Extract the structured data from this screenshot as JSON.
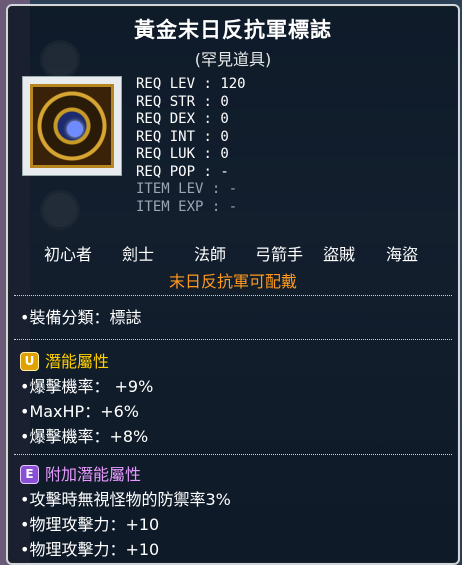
{
  "item": {
    "name": "黃金末日反抗軍標誌",
    "rarity": "(罕見道具)",
    "icon": "gold-emblem-icon"
  },
  "requirements": [
    {
      "label": "REQ LEV",
      "value": "120",
      "dim": false
    },
    {
      "label": "REQ STR",
      "value": "0",
      "dim": false
    },
    {
      "label": "REQ DEX",
      "value": "0",
      "dim": false
    },
    {
      "label": "REQ INT",
      "value": "0",
      "dim": false
    },
    {
      "label": "REQ LUK",
      "value": "0",
      "dim": false
    },
    {
      "label": "REQ POP",
      "value": "-",
      "dim": false
    },
    {
      "label": "ITEM LEV",
      "value": "-",
      "dim": true
    },
    {
      "label": "ITEM EXP",
      "value": "-",
      "dim": true
    }
  ],
  "jobs": [
    "初心者",
    "劍士",
    "法師",
    "弓箭手",
    "盜賊",
    "海盜"
  ],
  "equip_notice": "末日反抗軍可配戴",
  "category_line": "•裝備分類：標誌",
  "potential": {
    "badge": "U",
    "title": "潛能屬性",
    "lines": [
      "•爆擊機率： +9%",
      "•MaxHP：+6%",
      "•爆擊機率：+8%"
    ]
  },
  "bonus_potential": {
    "badge": "E",
    "title": "附加潛能屬性",
    "lines": [
      "•攻擊時無視怪物的防禦率3%",
      "•物理攻擊力：+10",
      "•物理攻擊力：+10"
    ]
  },
  "colors": {
    "notice": "#ff9a1e",
    "potential_title": "#ffd000",
    "bonus_title": "#e79aff",
    "panel_bg": "#08121e"
  }
}
